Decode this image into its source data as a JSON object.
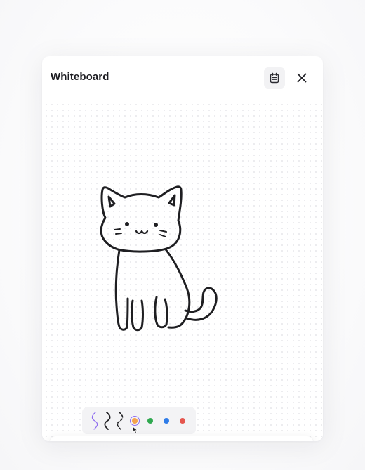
{
  "window": {
    "title": "Whiteboard"
  },
  "header": {
    "notes_icon": "notes-icon",
    "close_icon": "close-icon"
  },
  "stroke_styles": [
    {
      "name": "solid-stroke",
      "icon": "wave-thin-icon"
    },
    {
      "name": "bold-stroke",
      "icon": "wave-bold-icon"
    },
    {
      "name": "dashed-stroke",
      "icon": "wave-dashed-icon"
    }
  ],
  "colors": [
    {
      "name": "orange",
      "hex": "#F4A24C",
      "selected": true
    },
    {
      "name": "green",
      "hex": "#2FA84F",
      "selected": false
    },
    {
      "name": "blue",
      "hex": "#2F7CE8",
      "selected": false
    },
    {
      "name": "red",
      "hex": "#E5564E",
      "selected": false
    }
  ],
  "accent": "#8E6CF0",
  "toolbar": {
    "tools": [
      {
        "name": "select-tool",
        "icon": "pointer-icon",
        "active": false
      },
      {
        "name": "pen-tool",
        "icon": "pencil-icon",
        "active": true
      },
      {
        "name": "text-tool",
        "icon": "text-icon",
        "active": false
      },
      {
        "name": "link-tool",
        "icon": "link-icon",
        "active": false
      },
      {
        "name": "shapes-tool",
        "icon": "shapes-icon",
        "active": false
      },
      {
        "name": "archive-tool",
        "icon": "archive-icon",
        "active": false
      }
    ],
    "close_icon": "close-icon"
  }
}
